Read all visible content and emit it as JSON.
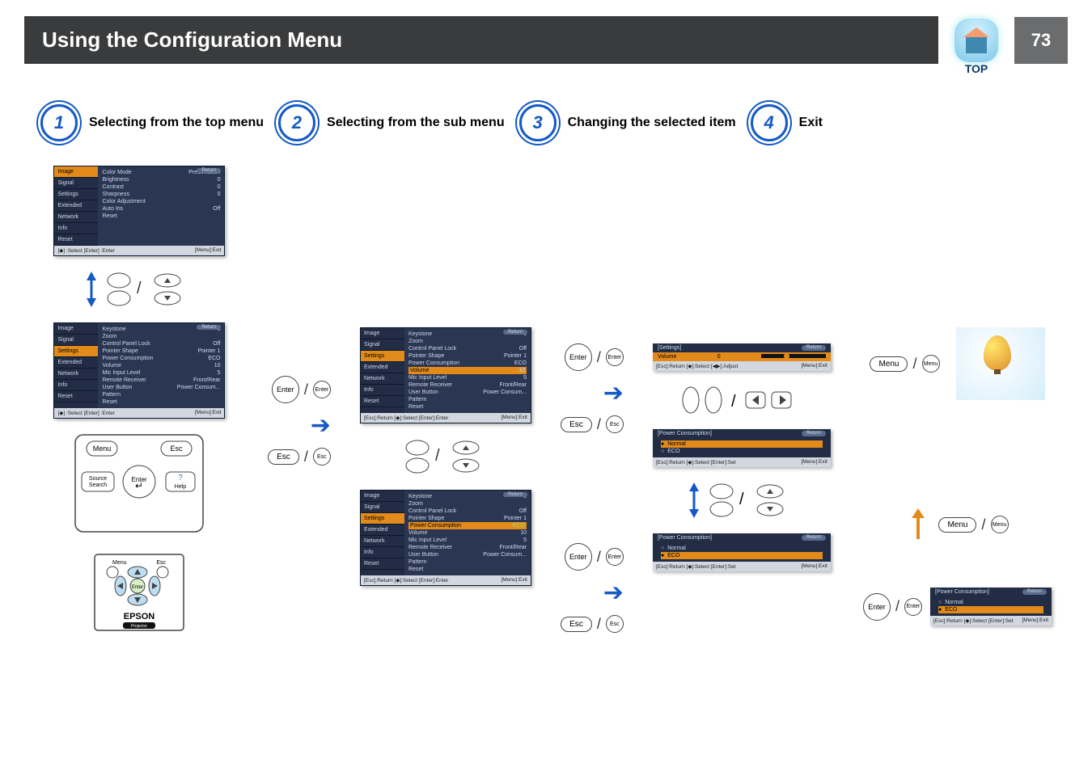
{
  "header": {
    "title": "Using the Configuration Menu",
    "top_label": "TOP",
    "page_number": "73"
  },
  "steps": [
    {
      "num": "1",
      "label": "Selecting from the top menu"
    },
    {
      "num": "2",
      "label": "Selecting from the sub menu"
    },
    {
      "num": "3",
      "label": "Changing the selected item"
    },
    {
      "num": "4",
      "label": "Exit"
    }
  ],
  "menu": {
    "left_items": [
      "Image",
      "Signal",
      "Settings",
      "Extended",
      "Network",
      "Info",
      "Reset"
    ],
    "return": "Return",
    "image_rows": [
      {
        "k": "Color Mode",
        "v": "Presentation"
      },
      {
        "k": "Brightness",
        "v": "0"
      },
      {
        "k": "Contrast",
        "v": "0"
      },
      {
        "k": "Sharpness",
        "v": "0"
      },
      {
        "k": "Color Adjustment",
        "v": ""
      },
      {
        "k": "Auto Iris",
        "v": "Off"
      },
      {
        "k": "Reset",
        "v": ""
      }
    ],
    "settings_rows": [
      {
        "k": "Keystone",
        "v": "0"
      },
      {
        "k": "Zoom",
        "v": ""
      },
      {
        "k": "Control Panel Lock",
        "v": "Off"
      },
      {
        "k": "Pointer Shape",
        "v": "Pointer 1"
      },
      {
        "k": "Power Consumption",
        "v": "ECO"
      },
      {
        "k": "Volume",
        "v": "10"
      },
      {
        "k": "Mic Input Level",
        "v": "5"
      },
      {
        "k": "Remote Receiver",
        "v": "Front/Rear"
      },
      {
        "k": "User Button",
        "v": "Power Consum..."
      },
      {
        "k": "Pattern",
        "v": ""
      },
      {
        "k": "Reset",
        "v": ""
      }
    ],
    "foot_a": "[◆] :Select  [Enter] :Enter",
    "foot_b": "[Menu]:Exit",
    "foot_c": "[Esc]:Return [◆]:Select [Enter]:Enter"
  },
  "settings_bar": {
    "head": "[Settings]",
    "return": "Return",
    "label": "Volume",
    "value": "0",
    "foot_a": "[Esc]:Return [◆]:Select [◀▶]:Adjust",
    "foot_b": "[Menu]:Exit"
  },
  "power": {
    "head": "[Power Consumption]",
    "return": "Return",
    "opt1": "Normal",
    "opt2": "ECO",
    "foot_a": "[Esc]:Return [◆]:Select [Enter]:Set",
    "foot_b": "[Menu]:Exit"
  },
  "buttons": {
    "menu": "Menu",
    "esc": "Esc",
    "enter": "Enter",
    "source": "Source\nSearch",
    "help": "Help",
    "enter_small": "Enter",
    "esc_small": "Esc",
    "menu_small": "Menu"
  },
  "brand": {
    "name": "EPSON",
    "sub": "Projector"
  }
}
